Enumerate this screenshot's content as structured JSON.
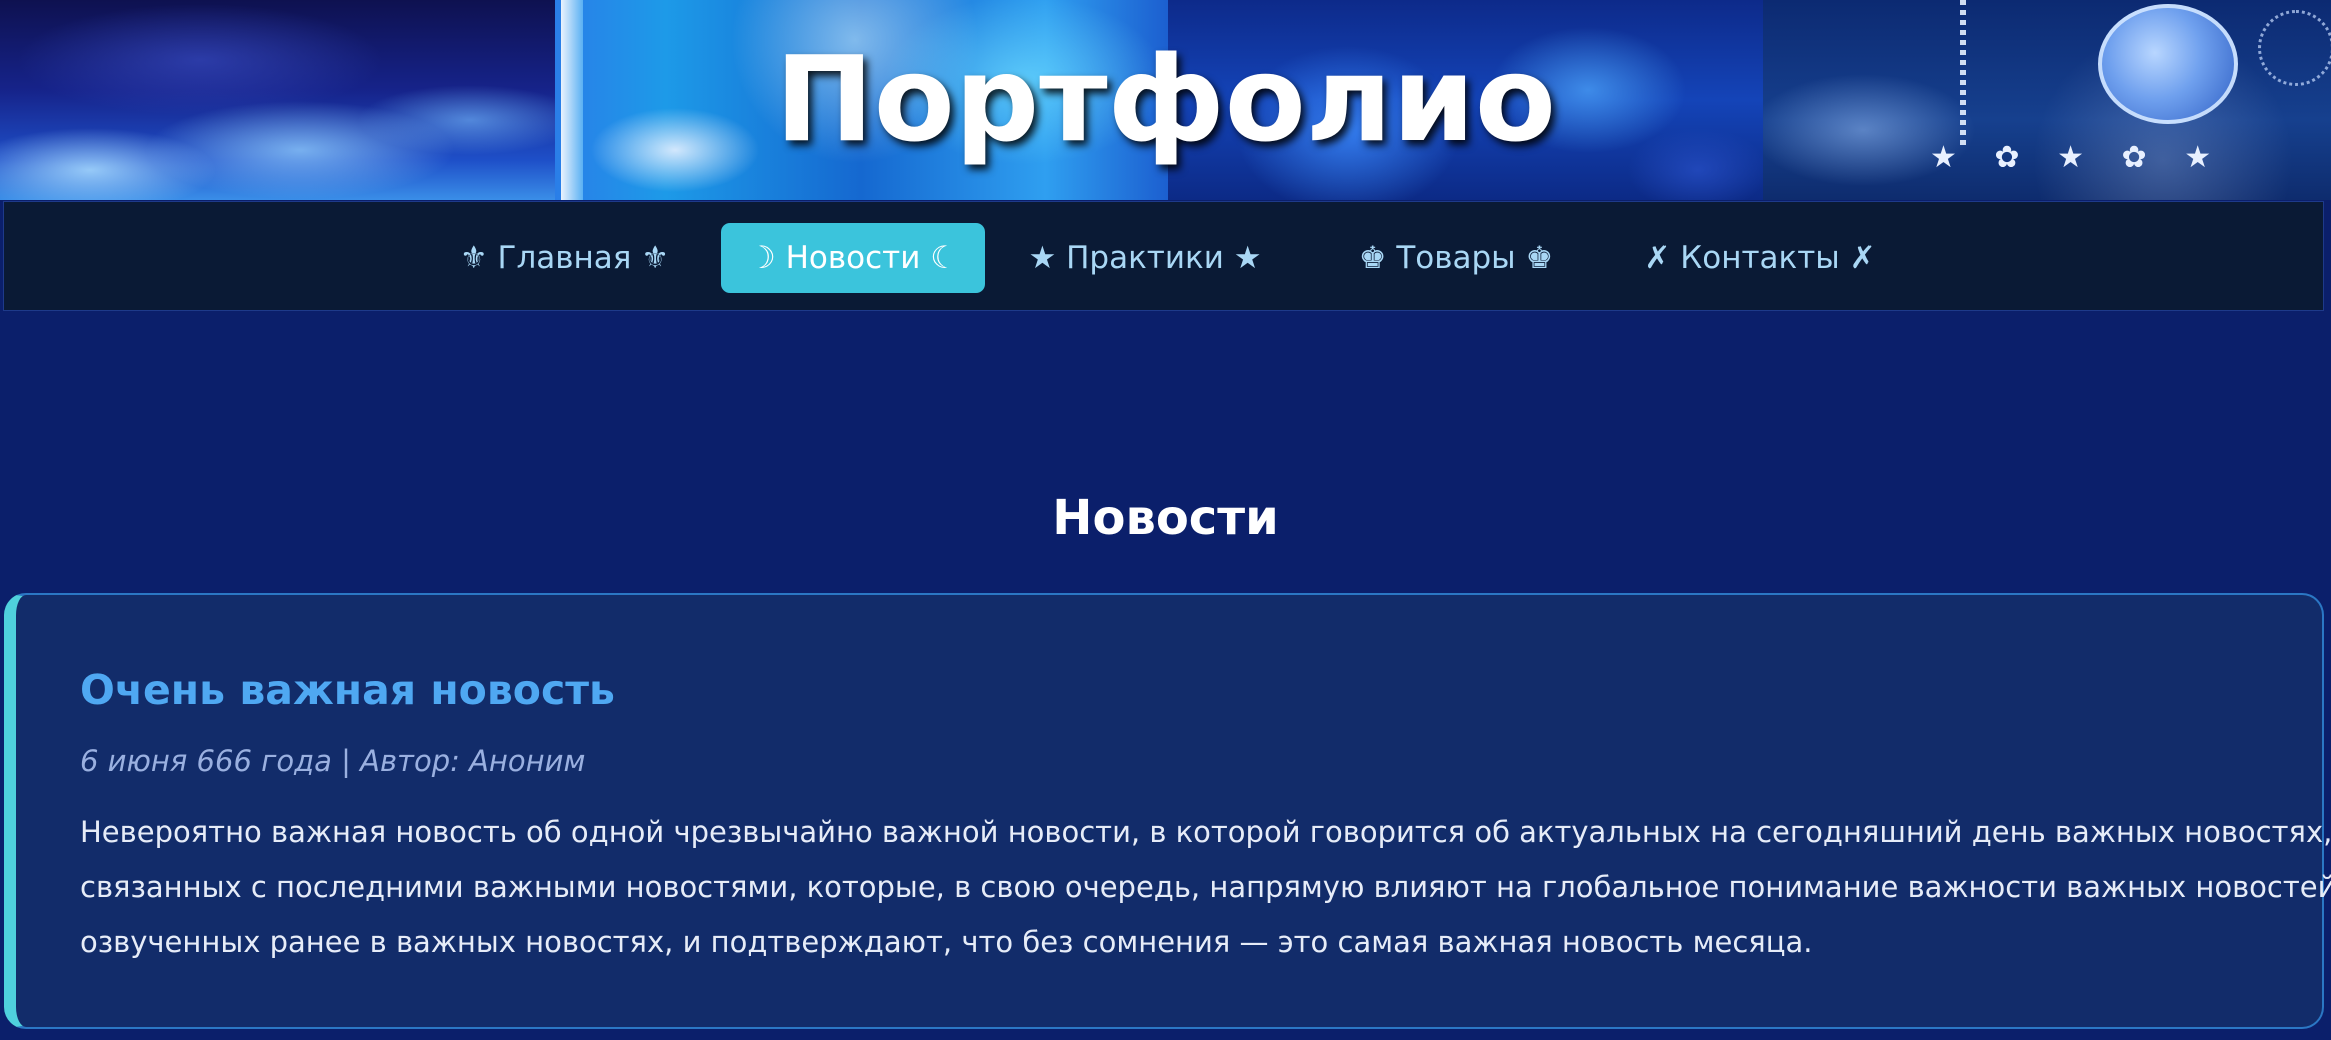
{
  "header": {
    "site_title": "Портфолио"
  },
  "nav": {
    "items": [
      {
        "label": "⚜ Главная ⚜",
        "active": false
      },
      {
        "label": "☽ Новости ☾",
        "active": true
      },
      {
        "label": "★ Практики ★",
        "active": false
      },
      {
        "label": "♚ Товары ♚",
        "active": false
      },
      {
        "label": "✗ Контакты ✗",
        "active": false
      }
    ]
  },
  "main": {
    "section_title": "Новости",
    "news": [
      {
        "title": "Очень важная новость",
        "meta": "6 июня 666 года | Автор: Аноним",
        "body_lines": [
          "Невероятно важная новость об одной чрезвычайно важной новости, в которой говорится об актуальных на сегодняшний день важных новостях,",
          "связанных с последними важными новостями, которые, в свою очередь, напрямую влияют на глобальное понимание важности важных новостей,",
          "озвученных ранее в важных новостях, и подтверждают, что без сомнения — это самая важная новость месяца."
        ]
      }
    ]
  },
  "colors": {
    "page_background": "#0b1f6b",
    "nav_background": "#0a1a35",
    "nav_active": "#3bc4dc",
    "nav_text": "#a9d7f5",
    "card_background": "#122c6a",
    "card_accent": "#4fd0dd",
    "news_title": "#4fa8f2"
  }
}
